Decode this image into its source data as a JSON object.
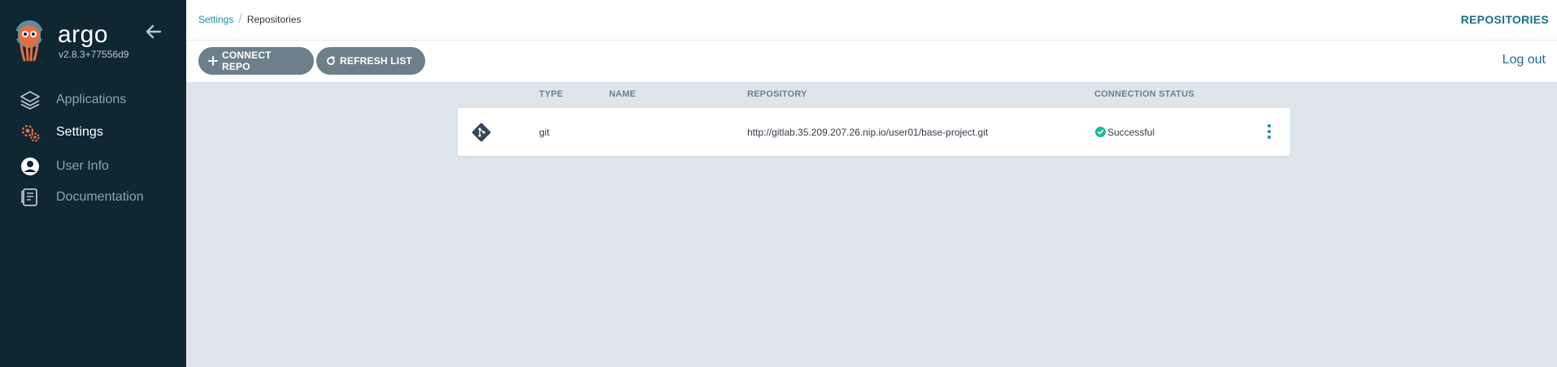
{
  "sidebar": {
    "logo_text": "argo",
    "version": "v2.8.3+77556d9",
    "items": [
      {
        "label": "Applications",
        "icon": "stack-layers-icon",
        "active": false
      },
      {
        "label": "Settings",
        "icon": "gears-icon",
        "active": true
      },
      {
        "label": "User Info",
        "icon": "user-circle-icon",
        "active": false
      },
      {
        "label": "Documentation",
        "icon": "book-icon",
        "active": false
      }
    ]
  },
  "header": {
    "breadcrumb": [
      {
        "label": "Settings"
      },
      {
        "label": "Repositories"
      }
    ],
    "title": "REPOSITORIES"
  },
  "toolbar": {
    "connect_label": "CONNECT REPO",
    "refresh_label": "REFRESH LIST",
    "logout_label": "Log out"
  },
  "table": {
    "columns": [
      "TYPE",
      "NAME",
      "REPOSITORY",
      "CONNECTION STATUS"
    ],
    "rows": [
      {
        "type": "git",
        "name": "",
        "repository": "http://gitlab.35.209.207.26.nip.io/user01/base-project.git",
        "status": "Successful",
        "status_color": "#18be94"
      }
    ]
  },
  "colors": {
    "sidebar_bg": "#0f2733",
    "accent": "#1b8ea8",
    "button_bg": "#6d7f8b",
    "page_bg": "#dee6eb",
    "argo_orange": "#e96d41"
  }
}
